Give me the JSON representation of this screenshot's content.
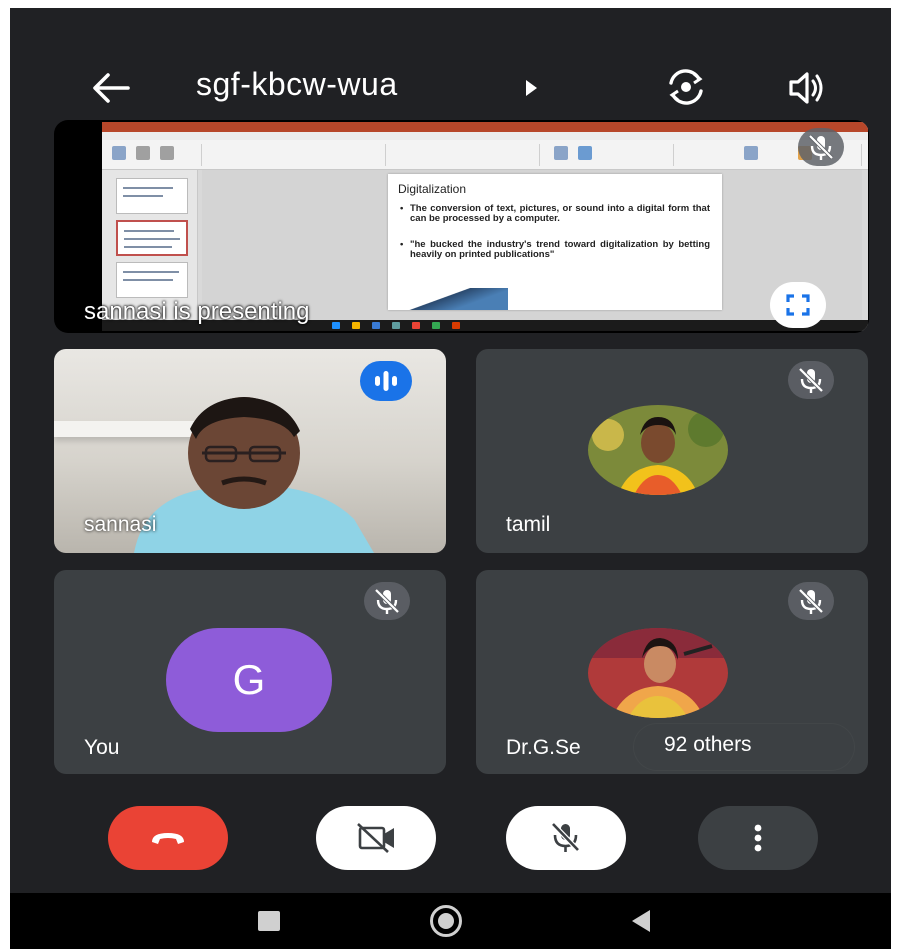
{
  "meeting": {
    "code": "sgf-kbcw-wua"
  },
  "icons": {
    "back": "arrow-left-icon",
    "title_caret": "play-caret-icon",
    "camera_switch": "switch-camera-icon",
    "speaker": "speaker-icon",
    "muted": "mic-off-icon",
    "fullscreen": "fullscreen-icon",
    "speaking": "audio-wave-icon",
    "end_call": "phone-hangup-icon",
    "camera_off": "video-off-icon",
    "mic_off": "mic-off-icon",
    "more": "more-vertical-icon",
    "nav_recents": "square-icon",
    "nav_home": "circle-icon",
    "nav_back": "triangle-back-icon"
  },
  "presentation": {
    "label": "sannasi is presenting",
    "slide": {
      "heading": "Digitalization",
      "bullets": [
        "The conversion of text, pictures, or sound into a digital form that can be processed by a computer.",
        "\"he bucked the industry's trend toward digitalization by betting heavily on printed publications\""
      ]
    }
  },
  "participants": [
    {
      "name": "sannasi",
      "speaking": true,
      "video": true
    },
    {
      "name": "tamil",
      "muted": true,
      "video": false
    },
    {
      "name": "You",
      "avatar_letter": "G",
      "muted": true,
      "video": false
    },
    {
      "name": "Dr.G.Se",
      "muted": true,
      "video": false
    }
  ],
  "others": {
    "label": "92 others"
  },
  "colors": {
    "background": "#202124",
    "tile": "#3c4043",
    "end_call": "#ea4335",
    "speaking_badge": "#1a73e8",
    "you_avatar": "#8e5cd9"
  }
}
